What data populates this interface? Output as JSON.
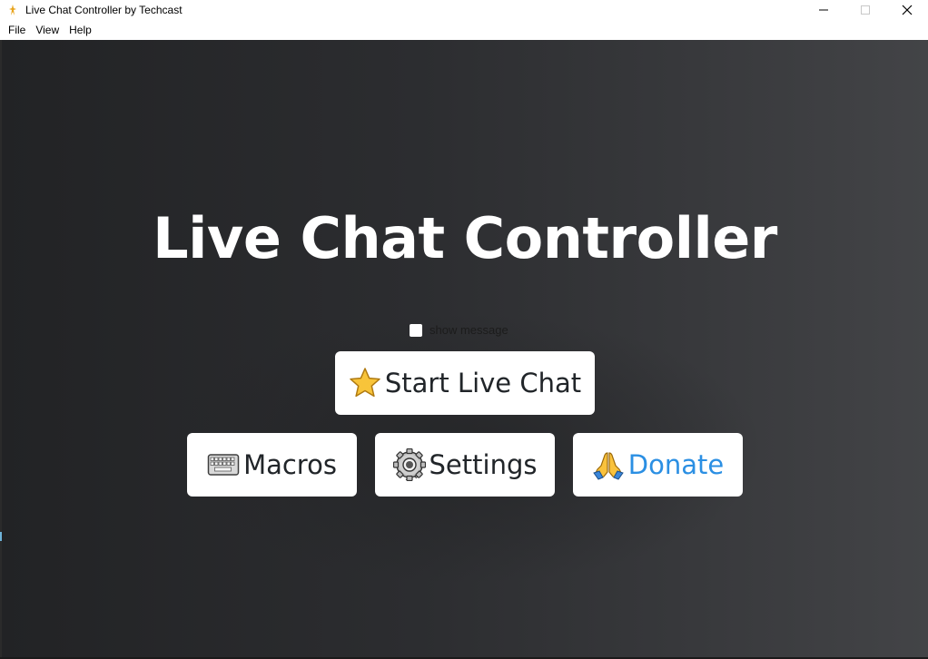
{
  "window": {
    "title": "Live Chat Controller by Techcast",
    "controls": {
      "minimize": "minimize-icon",
      "maximize": "maximize-icon",
      "close": "close-icon"
    }
  },
  "menubar": {
    "items": [
      {
        "label": "File"
      },
      {
        "label": "View"
      },
      {
        "label": "Help"
      }
    ]
  },
  "main": {
    "heading": "Live Chat Controller",
    "show_message": {
      "label": "show message",
      "checked": false
    },
    "buttons": {
      "start": {
        "label": "Start Live Chat",
        "icon": "star-icon"
      },
      "macros": {
        "label": "Macros",
        "icon": "keyboard-icon"
      },
      "settings": {
        "label": "Settings",
        "icon": "gear-icon"
      },
      "donate": {
        "label": "Donate",
        "icon": "folded-hands-icon"
      }
    }
  },
  "colors": {
    "background_dark": "#222325",
    "background_light": "#434447",
    "button_bg": "#ffffff",
    "donate_text": "#2b8fe3"
  }
}
